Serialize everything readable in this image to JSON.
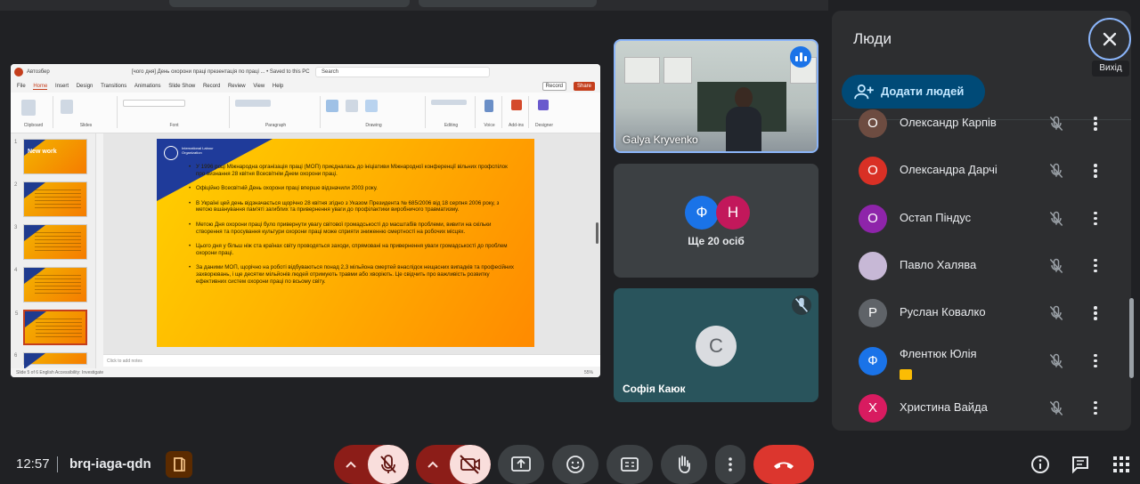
{
  "meet": {
    "clock": "12:57",
    "meeting_code": "brq-iaga-qdn"
  },
  "presentation": {
    "title_bar": {
      "autosave": "Автозбер",
      "file_name": "[чого дня] День охорони праці презентація по праці ...  •  Saved to this PC",
      "search_placeholder": "Search"
    },
    "menu": [
      "File",
      "Home",
      "Insert",
      "Design",
      "Transitions",
      "Animations",
      "Slide Show",
      "Record",
      "Review",
      "View",
      "Help"
    ],
    "selected_menu": "Home",
    "record_label": "Record",
    "share_label": "Share",
    "ribbon_groups": [
      "Clipboard",
      "Slides",
      "Font",
      "Paragraph",
      "Drawing",
      "Editing",
      "Voice",
      "Add-ins",
      "Designer"
    ],
    "thumb_numbers": [
      "1",
      "2",
      "3",
      "4",
      "5",
      "6"
    ],
    "thumb_title": "New work",
    "notes_placeholder": "Click to add notes",
    "status_text": "Slide 5 of 6   English   Accessibility: Investigate",
    "zoom": "55%",
    "slide": {
      "logo_text": "International Labour Organization",
      "bullets": [
        "У 1996 році Міжнародна організація праці (МОП) приєдналась до ініціативи Міжнародної конференції вільних профспілок про визнання 28 квітня Всесвітнім Днем охорони праці.",
        "Офіційно Всесвітній День охорони праці вперше відзначили 2003 року.",
        "В Україні цей день відзначається щорічно 28 квітня згідно з Указом Президента № 685/2006 від 18 серпня 2006 року, з метою вшанування пам'яті загиблих та привернення уваги до профілактики виробничого травматизму.",
        "Метою Дня охорони праці було привернути увагу світової громадськості до масштабів проблеми, вивити на скільки створення та просування культури охорони праці може сприяти зниженню смертності на робочих місцях.",
        "Цього дня у більш ніж ста країнах світу проводяться заходи, спрямовані на привернення уваги громадськості до проблем охорони праці.",
        "За даними МОП, щорічно на роботі відбуваються понад 2,3 мільйона смертей внаслідок нещасних випадків та професійних захворювань, і ще десятки мільйонів людей отримують травми або хворіють. Це свідчить про важливість розвитку ефективних систем охорони праці по всьому світу."
      ]
    }
  },
  "tiles": {
    "speaker_name": "Galya Kryvenko",
    "group_avatars": [
      {
        "letter": "Ф",
        "color": "#1a73e8"
      },
      {
        "letter": "Н",
        "color": "#c2185b"
      }
    ],
    "group_label": "Ще 20 осіб",
    "bottom_avatar": "С",
    "bottom_name": "Софія Каюк"
  },
  "people": {
    "title": "Люди",
    "close_tooltip": "Вихід",
    "add_button": "Додати людей",
    "list": [
      {
        "initial": "О",
        "name": "Олександр Карпів",
        "color": "#6d4c41",
        "badge": false
      },
      {
        "initial": "О",
        "name": "Олександра Дарчі",
        "color": "#d93025",
        "badge": false
      },
      {
        "initial": "О",
        "name": "Остап Піндус",
        "color": "#8e24aa",
        "badge": false
      },
      {
        "initial": "",
        "name": "Павло Халява",
        "color": "#c7b8d6",
        "badge": false
      },
      {
        "initial": "Р",
        "name": "Руслан Ковалко",
        "color": "#5f6368",
        "badge": false
      },
      {
        "initial": "Ф",
        "name": "Флентюк Юлія",
        "color": "#1a73e8",
        "badge": true
      },
      {
        "initial": "Х",
        "name": "Христина Вайда",
        "color": "#d81b60",
        "badge": false
      }
    ]
  },
  "colors": {
    "background": "#202124",
    "panel": "#2d2e30",
    "accent": "#8ab4f8",
    "danger": "#dc362e",
    "muted_red": "#8c1d18",
    "add_button_bg": "#004a77"
  },
  "icons": [
    "mic-off-icon",
    "camera-off-icon",
    "present-icon",
    "emoji-icon",
    "captions-icon",
    "raise-hand-icon",
    "more-options-icon",
    "end-call-icon",
    "info-icon",
    "chat-icon",
    "activities-icon",
    "close-icon",
    "add-person-icon"
  ]
}
